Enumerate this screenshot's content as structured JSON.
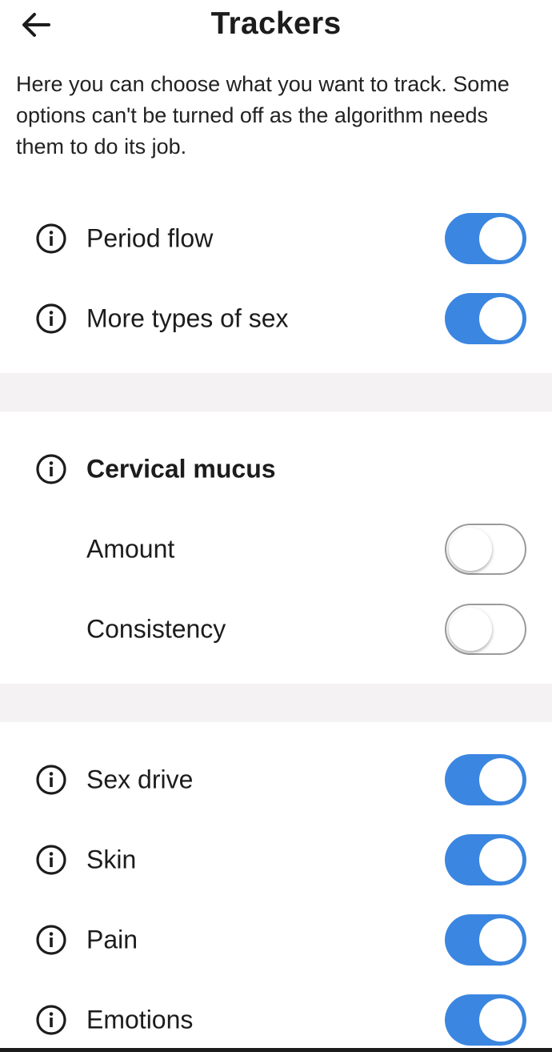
{
  "header": {
    "title": "Trackers",
    "back_icon": "arrow-left-icon"
  },
  "intro_text": "Here you can choose what you want to track. Some options can't be turned off as the algorithm needs them to do its job.",
  "section_1": {
    "items": [
      {
        "label": "Period flow",
        "enabled": true
      },
      {
        "label": "More types of sex",
        "enabled": true
      }
    ]
  },
  "section_2": {
    "heading": "Cervical mucus",
    "items": [
      {
        "label": "Amount",
        "enabled": false
      },
      {
        "label": "Consistency",
        "enabled": false
      }
    ]
  },
  "section_3": {
    "items": [
      {
        "label": "Sex drive",
        "enabled": true
      },
      {
        "label": "Skin",
        "enabled": true
      },
      {
        "label": "Pain",
        "enabled": true
      },
      {
        "label": "Emotions",
        "enabled": true
      }
    ]
  },
  "colors": {
    "toggle_on": "#3b86e0",
    "divider": "#f4f2f2",
    "text": "#1c1c1c"
  }
}
